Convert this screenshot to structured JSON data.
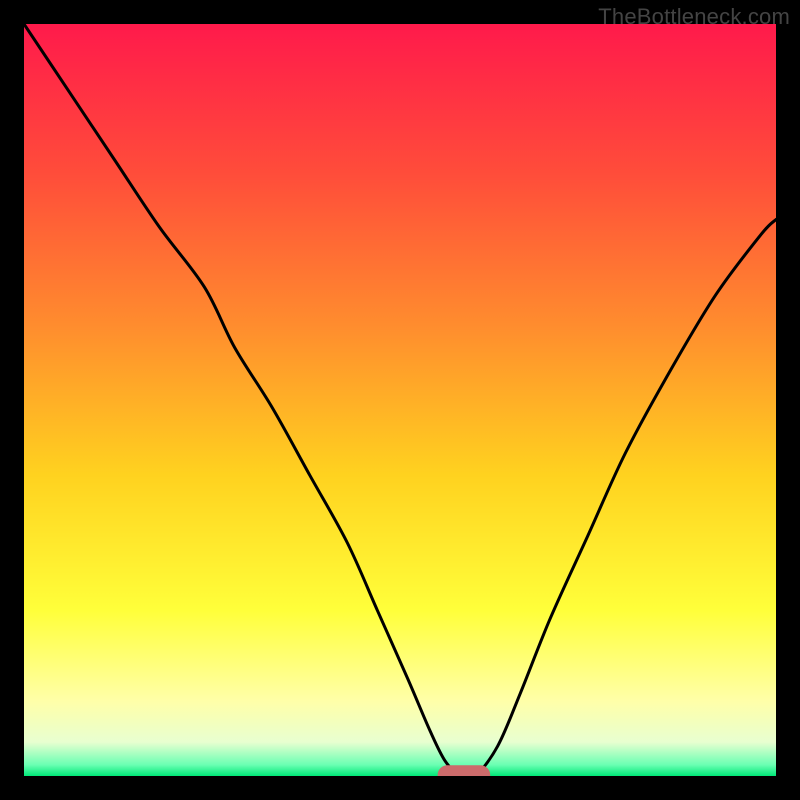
{
  "watermark": "TheBottleneck.com",
  "chart_data": {
    "type": "line",
    "title": "",
    "xlabel": "",
    "ylabel": "",
    "xlim": [
      0,
      100
    ],
    "ylim": [
      0,
      100
    ],
    "grid": false,
    "legend": false,
    "background_gradient_stops": [
      {
        "offset": 0.0,
        "color": "#ff1a4b"
      },
      {
        "offset": 0.2,
        "color": "#ff4d3a"
      },
      {
        "offset": 0.4,
        "color": "#ff8c2e"
      },
      {
        "offset": 0.6,
        "color": "#ffd21f"
      },
      {
        "offset": 0.78,
        "color": "#ffff3a"
      },
      {
        "offset": 0.9,
        "color": "#ffffa8"
      },
      {
        "offset": 0.955,
        "color": "#e8ffd0"
      },
      {
        "offset": 0.985,
        "color": "#6bffb3"
      },
      {
        "offset": 1.0,
        "color": "#00e878"
      }
    ],
    "series": [
      {
        "name": "bottleneck-curve",
        "x": [
          0,
          6,
          12,
          18,
          24,
          28,
          33,
          38,
          43,
          47,
          51,
          54,
          56,
          58,
          60,
          63,
          66,
          70,
          75,
          80,
          86,
          92,
          98,
          100
        ],
        "y": [
          100,
          91,
          82,
          73,
          65,
          57,
          49,
          40,
          31,
          22,
          13,
          6,
          2,
          0,
          0,
          4,
          11,
          21,
          32,
          43,
          54,
          64,
          72,
          74
        ]
      }
    ],
    "marker": {
      "name": "min-marker",
      "x_center": 58.5,
      "y": 0,
      "width": 7,
      "height": 2.6,
      "color": "#cc6b6b",
      "radius": 1.3
    }
  }
}
